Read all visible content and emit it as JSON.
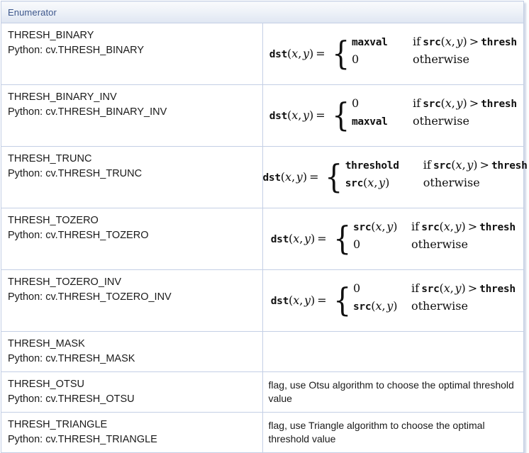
{
  "table": {
    "header": {
      "label": "Enumerator"
    },
    "rows": [
      {
        "name": "THRESH_BINARY",
        "python": "Python: cv.THRESH_BINARY",
        "kind": "formula",
        "formula": {
          "lhs": "dst(x, y) =",
          "true_value": "maxval",
          "false_value": "0",
          "condition": "if src(x, y) > thresh",
          "otherwise": "otherwise",
          "width_class": "w-maxval"
        }
      },
      {
        "name": "THRESH_BINARY_INV",
        "python": "Python: cv.THRESH_BINARY_INV",
        "kind": "formula",
        "formula": {
          "lhs": "dst(x, y) =",
          "true_value": "0",
          "false_value": "maxval",
          "condition": "if src(x, y) > thresh",
          "otherwise": "otherwise",
          "width_class": "w-maxval"
        }
      },
      {
        "name": "THRESH_TRUNC",
        "python": "Python: cv.THRESH_TRUNC",
        "kind": "formula",
        "formula": {
          "lhs": "dst(x, y) =",
          "true_value": "threshold",
          "false_value": "src(x, y)",
          "condition": "if src(x, y) > thresh",
          "otherwise": "otherwise",
          "width_class": "w-threshold"
        }
      },
      {
        "name": "THRESH_TOZERO",
        "python": "Python: cv.THRESH_TOZERO",
        "kind": "formula",
        "formula": {
          "lhs": "dst(x, y) =",
          "true_value": "src(x, y)",
          "false_value": "0",
          "condition": "if src(x, y) > thresh",
          "otherwise": "otherwise",
          "width_class": "w-src"
        }
      },
      {
        "name": "THRESH_TOZERO_INV",
        "python": "Python: cv.THRESH_TOZERO_INV",
        "kind": "formula",
        "formula": {
          "lhs": "dst(x, y) =",
          "true_value": "0",
          "false_value": "src(x, y)",
          "condition": "if src(x, y) > thresh",
          "otherwise": "otherwise",
          "width_class": "w-src"
        }
      },
      {
        "name": "THRESH_MASK",
        "python": "Python: cv.THRESH_MASK",
        "kind": "empty",
        "description": ""
      },
      {
        "name": "THRESH_OTSU",
        "python": "Python: cv.THRESH_OTSU",
        "kind": "text",
        "description": "flag, use Otsu algorithm to choose the optimal threshold value"
      },
      {
        "name": "THRESH_TRIANGLE",
        "python": "Python: cv.THRESH_TRIANGLE",
        "kind": "text",
        "description": "flag, use Triangle algorithm to choose the optimal threshold value"
      }
    ]
  },
  "colors": {
    "border": "#c4cfe5",
    "header_text": "#3d578c",
    "header_bg_top": "#f9fafc",
    "header_bg_bottom": "#dfe6f2",
    "body_text": "#1a1a1a",
    "page_bg": "#ffffff"
  }
}
